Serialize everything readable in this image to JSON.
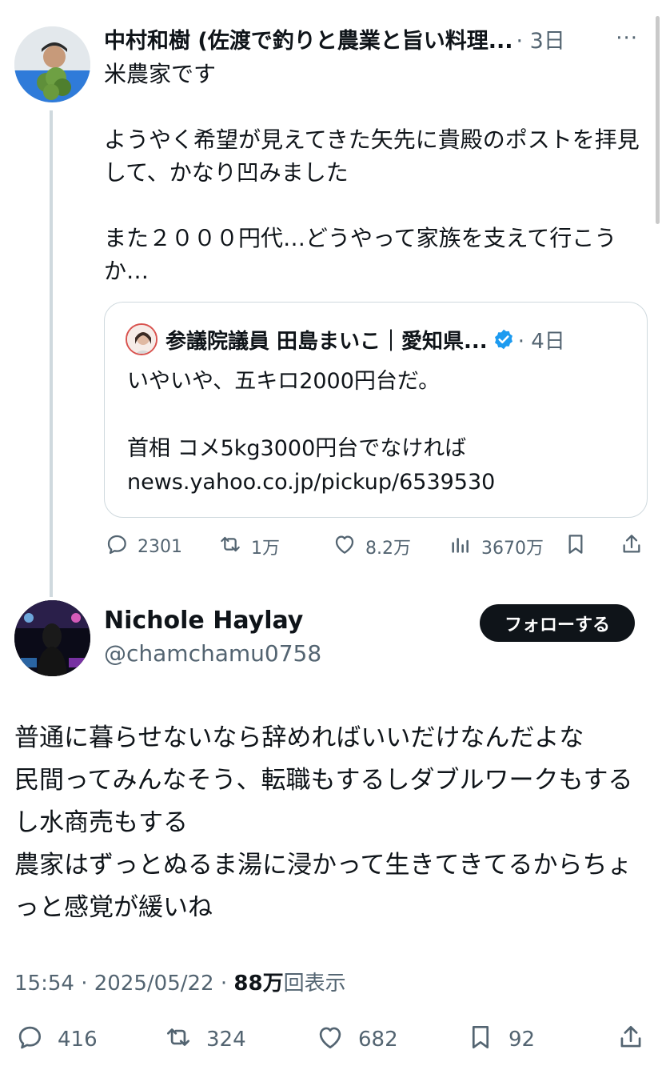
{
  "parent_tweet": {
    "author_name": "中村和樹 (佐渡で釣りと農業と旨い料理...",
    "time": "· 3日",
    "text": "米農家です\n\nようやく希望が見えてきた矢先に貴殿のポストを拝見して、かなり凹みました\n\nまた２０００円代…どうやって家族を支えて行こうか…",
    "quote": {
      "author_name": "参議院議員 田島まいこ｜愛知県...",
      "time": "· 4日",
      "text": "いやいや、五キロ2000円台だ。\n\n首相 コメ5kg3000円台でなければ\nnews.yahoo.co.jp/pickup/6539530"
    },
    "actions": {
      "replies": "2301",
      "reposts": "1万",
      "likes": "8.2万",
      "views": "3670万"
    }
  },
  "reply_tweet": {
    "author_name": "Nichole Haylay",
    "handle": "@chamchamu0758",
    "follow_label": "フォローする",
    "text": "普通に暮らせないなら辞めればいいだけなんだよな\n民間ってみんなそう、転職もするしダブルワークもするし水商売もする\n農家はずっとぬるま湯に浸かって生きてきてるからちょっと感覚が緩いね",
    "meta": {
      "time": "15:54",
      "date": "2025/05/22",
      "views_count": "88万",
      "views_label": "回表示"
    },
    "actions": {
      "replies": "416",
      "reposts": "324",
      "likes": "682",
      "bookmarks": "92"
    }
  },
  "colors": {
    "text": "#0f1419",
    "secondary": "#536471",
    "border": "#cfd9de",
    "verified": "#1d9bf0",
    "follow_button_bg": "#0f1419"
  },
  "icons": [
    "more-icon",
    "reply-icon",
    "repost-icon",
    "like-icon",
    "views-icon",
    "bookmark-icon",
    "share-icon",
    "verified-icon"
  ]
}
